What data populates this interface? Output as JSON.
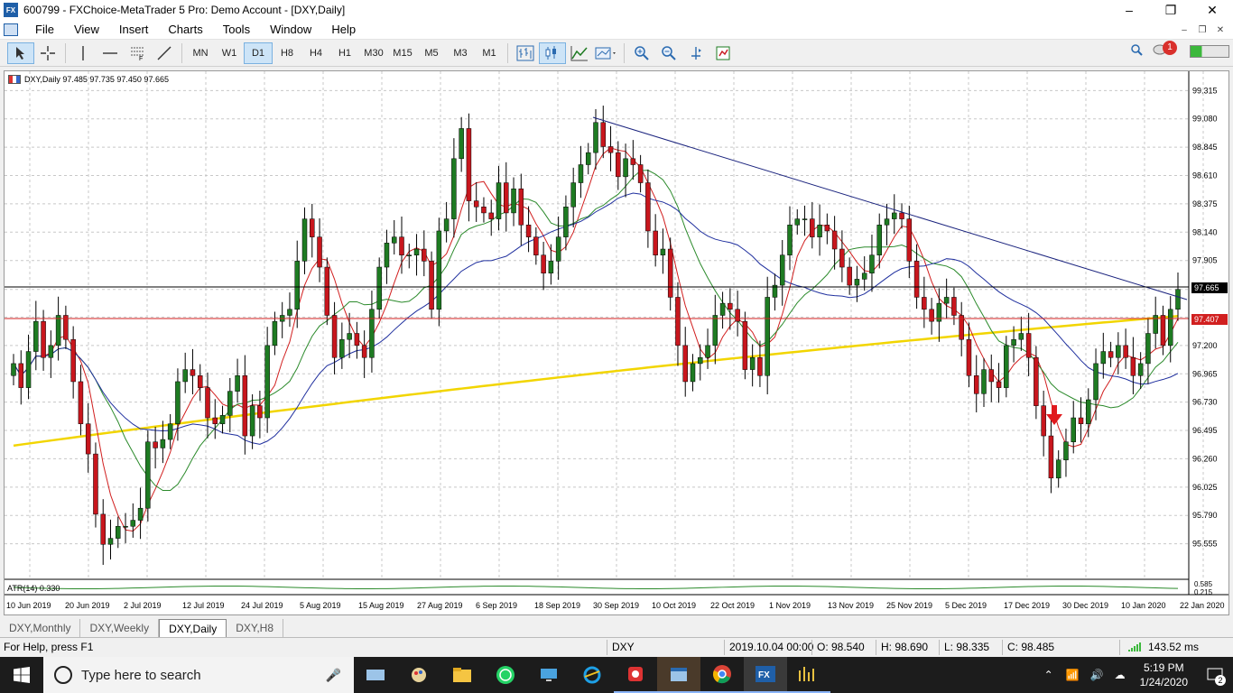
{
  "window": {
    "title": "600799 - FXChoice-MetaTrader 5 Pro: Demo Account - [DXY,Daily]"
  },
  "menu": [
    "File",
    "View",
    "Insert",
    "Charts",
    "Tools",
    "Window",
    "Help"
  ],
  "timeframes": [
    "MN",
    "W1",
    "D1",
    "H8",
    "H4",
    "H1",
    "M30",
    "M15",
    "M5",
    "M3",
    "M1"
  ],
  "active_timeframe": "D1",
  "notifications": {
    "count": "1"
  },
  "chart": {
    "info": "DXY,Daily  97.485 97.735 97.450 97.665",
    "atr_label": "ATR(14) 0.330",
    "price_tag_current": "97.665",
    "price_tag_line": "97.407",
    "atr_ticks": [
      "0.585",
      "0.215"
    ],
    "y_ticks": [
      "99.315",
      "99.080",
      "98.845",
      "98.610",
      "98.375",
      "98.140",
      "97.905",
      "97.665",
      "97.435",
      "97.200",
      "96.965",
      "96.730",
      "96.495",
      "96.260",
      "96.025",
      "95.790",
      "95.555"
    ],
    "x_ticks": [
      "10 Jun 2019",
      "20 Jun 2019",
      "2 Jul 2019",
      "12 Jul 2019",
      "24 Jul 2019",
      "5 Aug 2019",
      "15 Aug 2019",
      "27 Aug 2019",
      "6 Sep 2019",
      "18 Sep 2019",
      "30 Sep 2019",
      "10 Oct 2019",
      "22 Oct 2019",
      "1 Nov 2019",
      "13 Nov 2019",
      "25 Nov 2019",
      "5 Dec 2019",
      "17 Dec 2019",
      "30 Dec 2019",
      "10 Jan 2020",
      "22 Jan 2020"
    ],
    "colors": {
      "bull": "#1e7b22",
      "bear": "#c8161d",
      "ma200": "#f2d500",
      "ma_fast": "#d11f1f",
      "ma_mid": "#2b8a2b",
      "ma_slow": "#1f2f9e",
      "trendline": "#1a237e",
      "hline_red": "#d11f1f",
      "hline_black": "#000000"
    }
  },
  "chart_data": {
    "type": "candlestick",
    "symbol": "DXY",
    "timeframe": "Daily",
    "ylim": [
      95.32,
      99.4
    ],
    "ohlc_last": {
      "open": 97.485,
      "high": 97.735,
      "low": 97.45,
      "close": 97.665
    },
    "closes": [
      97.05,
      96.85,
      97.15,
      97.4,
      97.1,
      97.2,
      97.45,
      97.25,
      96.9,
      96.55,
      96.3,
      95.8,
      95.55,
      95.6,
      95.7,
      95.7,
      95.75,
      95.85,
      96.4,
      96.35,
      96.42,
      96.55,
      96.9,
      97.0,
      96.95,
      96.85,
      96.6,
      96.55,
      96.62,
      96.82,
      96.95,
      96.45,
      96.7,
      96.6,
      97.2,
      97.4,
      97.45,
      97.5,
      97.9,
      98.25,
      98.1,
      97.85,
      97.45,
      97.1,
      97.25,
      97.3,
      97.2,
      97.1,
      97.5,
      97.85,
      98.05,
      98.1,
      97.95,
      97.95,
      98.0,
      97.9,
      97.5,
      98.15,
      98.25,
      98.75,
      99.0,
      98.4,
      98.35,
      98.3,
      98.25,
      98.55,
      98.3,
      98.5,
      98.2,
      98.1,
      97.95,
      97.8,
      97.9,
      98.1,
      98.35,
      98.55,
      98.7,
      98.8,
      99.05,
      98.85,
      98.8,
      98.6,
      98.75,
      98.7,
      98.55,
      98.15,
      97.95,
      98.0,
      97.6,
      97.2,
      96.9,
      97.05,
      97.1,
      97.2,
      97.45,
      97.55,
      97.5,
      97.4,
      97.0,
      97.1,
      96.95,
      97.6,
      97.7,
      97.95,
      98.2,
      98.25,
      98.25,
      98.1,
      98.2,
      98.15,
      98.0,
      97.85,
      97.7,
      97.75,
      97.8,
      97.95,
      98.2,
      98.25,
      98.3,
      98.25,
      97.9,
      97.6,
      97.5,
      97.4,
      97.55,
      97.6,
      97.45,
      97.25,
      96.95,
      96.8,
      97.0,
      96.9,
      96.85,
      97.2,
      97.25,
      97.3,
      97.1,
      96.7,
      96.45,
      96.1,
      96.25,
      96.4,
      96.6,
      96.55,
      96.75,
      97.05,
      97.15,
      97.1,
      97.2,
      97.1,
      96.95,
      97.05,
      97.3,
      97.45,
      97.2,
      97.5,
      97.665
    ],
    "indicators": [
      "MA 200 (yellow)",
      "MA fast (red)",
      "MA mid (green)",
      "MA slow (blue)",
      "Descending trendline",
      "ATR(14)"
    ]
  },
  "tabs": [
    "DXY,Monthly",
    "DXY,Weekly",
    "DXY,Daily",
    "DXY,H8"
  ],
  "active_tab": "DXY,Daily",
  "status": {
    "help": "For Help, press F1",
    "symbol": "DXY",
    "datetime": "2019.10.04 00:00",
    "open": "O: 98.540",
    "high": "H: 98.690",
    "low": "L: 98.335",
    "close": "C: 98.485",
    "ping": "143.52 ms"
  },
  "taskbar": {
    "search_placeholder": "Type here to search",
    "time": "5:19 PM",
    "date": "1/24/2020",
    "notif_count": "2"
  }
}
